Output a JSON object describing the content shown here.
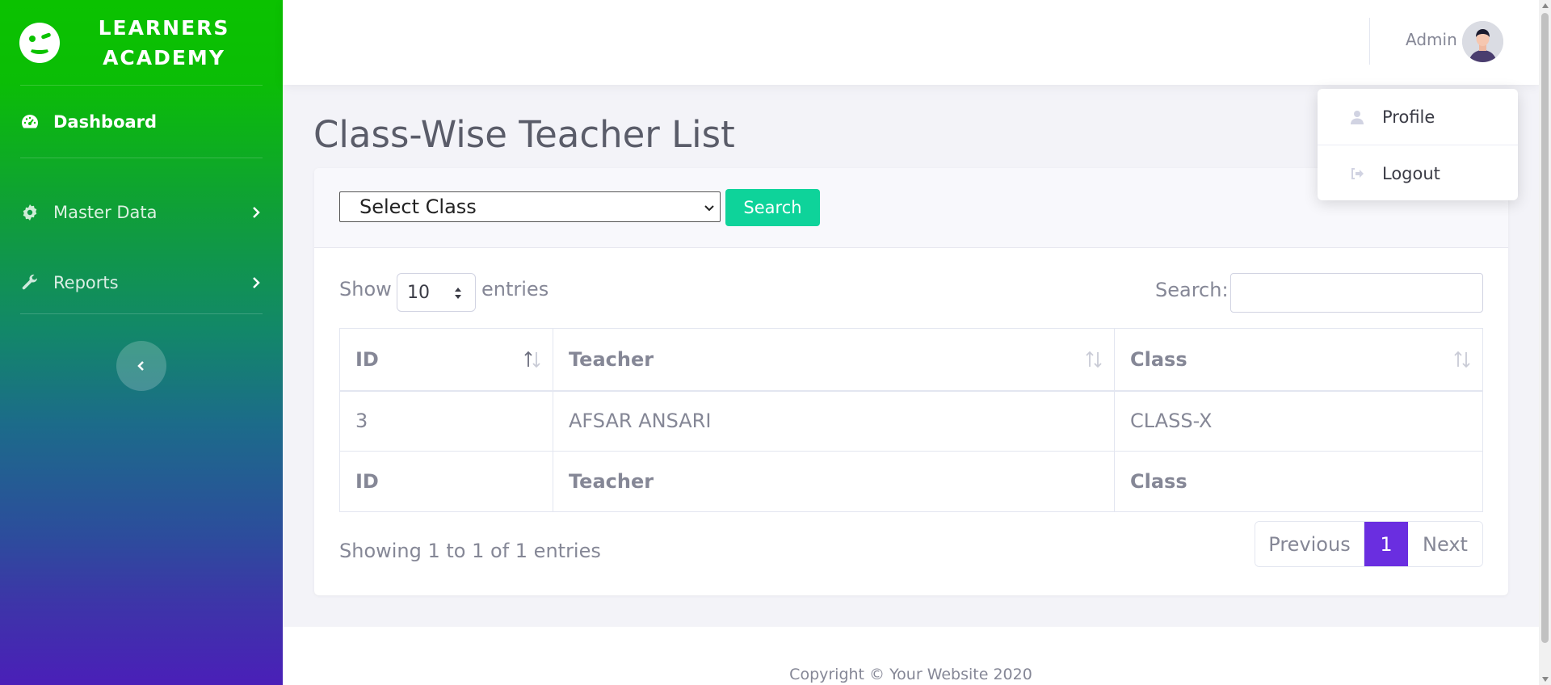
{
  "brand": {
    "line1": "LEARNERS",
    "line2": "ACADEMY"
  },
  "sidebar": {
    "items": [
      {
        "label": "Dashboard",
        "icon": "tachometer-icon"
      },
      {
        "label": "Master Data",
        "icon": "gear-icon"
      },
      {
        "label": "Reports",
        "icon": "wrench-icon"
      }
    ]
  },
  "topbar": {
    "user_name": "Admin"
  },
  "dropdown": {
    "profile": "Profile",
    "logout": "Logout"
  },
  "page": {
    "title": "Class-Wise Teacher List"
  },
  "filter": {
    "select_value": "Select Class",
    "search_button": "Search"
  },
  "table_controls": {
    "show_label": "Show",
    "page_length": "10",
    "entries_label": "entries",
    "search_label": "Search:"
  },
  "table": {
    "columns": [
      "ID",
      "Teacher",
      "Class"
    ],
    "rows": [
      [
        "3",
        "AFSAR ANSARI",
        "CLASS-X"
      ]
    ]
  },
  "table_info": "Showing 1 to 1 of 1 entries",
  "pagination": {
    "previous": "Previous",
    "current": "1",
    "next": "Next"
  },
  "footer": {
    "copyright": "Copyright © Your Website 2020"
  },
  "colors": {
    "primary_green": "#0bc200",
    "search_button": "#0ed39a",
    "active_page": "#6a2ee0"
  }
}
